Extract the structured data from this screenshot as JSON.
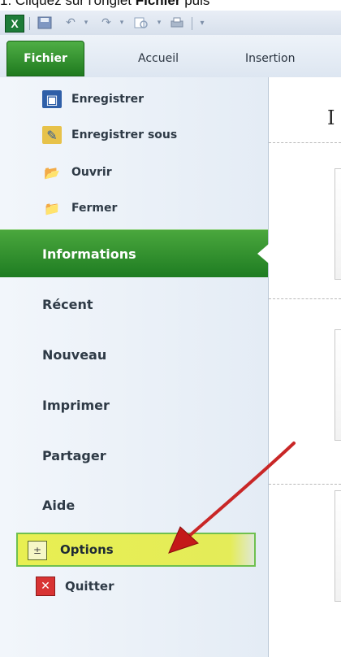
{
  "caption": {
    "prefix": "1. Cliquez sur l'onglet ",
    "bold": "Fichier",
    "suffix": " puis"
  },
  "quick_access": {
    "app_icon": "X",
    "icons": [
      "excel-logo",
      "save-icon",
      "undo-icon",
      "redo-icon",
      "print-preview-icon",
      "quick-print-icon",
      "customize-icon"
    ]
  },
  "ribbon": {
    "file_tab": "Fichier",
    "tabs": [
      "Accueil",
      "Insertion"
    ]
  },
  "backstage": {
    "commands": [
      {
        "label": "Enregistrer",
        "icon": "save-icon"
      },
      {
        "label": "Enregistrer sous",
        "icon": "save-as-icon"
      },
      {
        "label": "Ouvrir",
        "icon": "open-folder-icon"
      },
      {
        "label": "Fermer",
        "icon": "close-folder-icon"
      }
    ],
    "active": "Informations",
    "nav": [
      "Récent",
      "Nouveau",
      "Imprimer",
      "Partager",
      "Aide"
    ],
    "options": "Options",
    "quit": "Quitter"
  },
  "content": {
    "title_letter": "I"
  },
  "colors": {
    "file_tab": "#1f7a1f",
    "active_nav": "#2e8d2c",
    "highlight": "#e8ef52",
    "arrow": "#cc1f1f"
  }
}
